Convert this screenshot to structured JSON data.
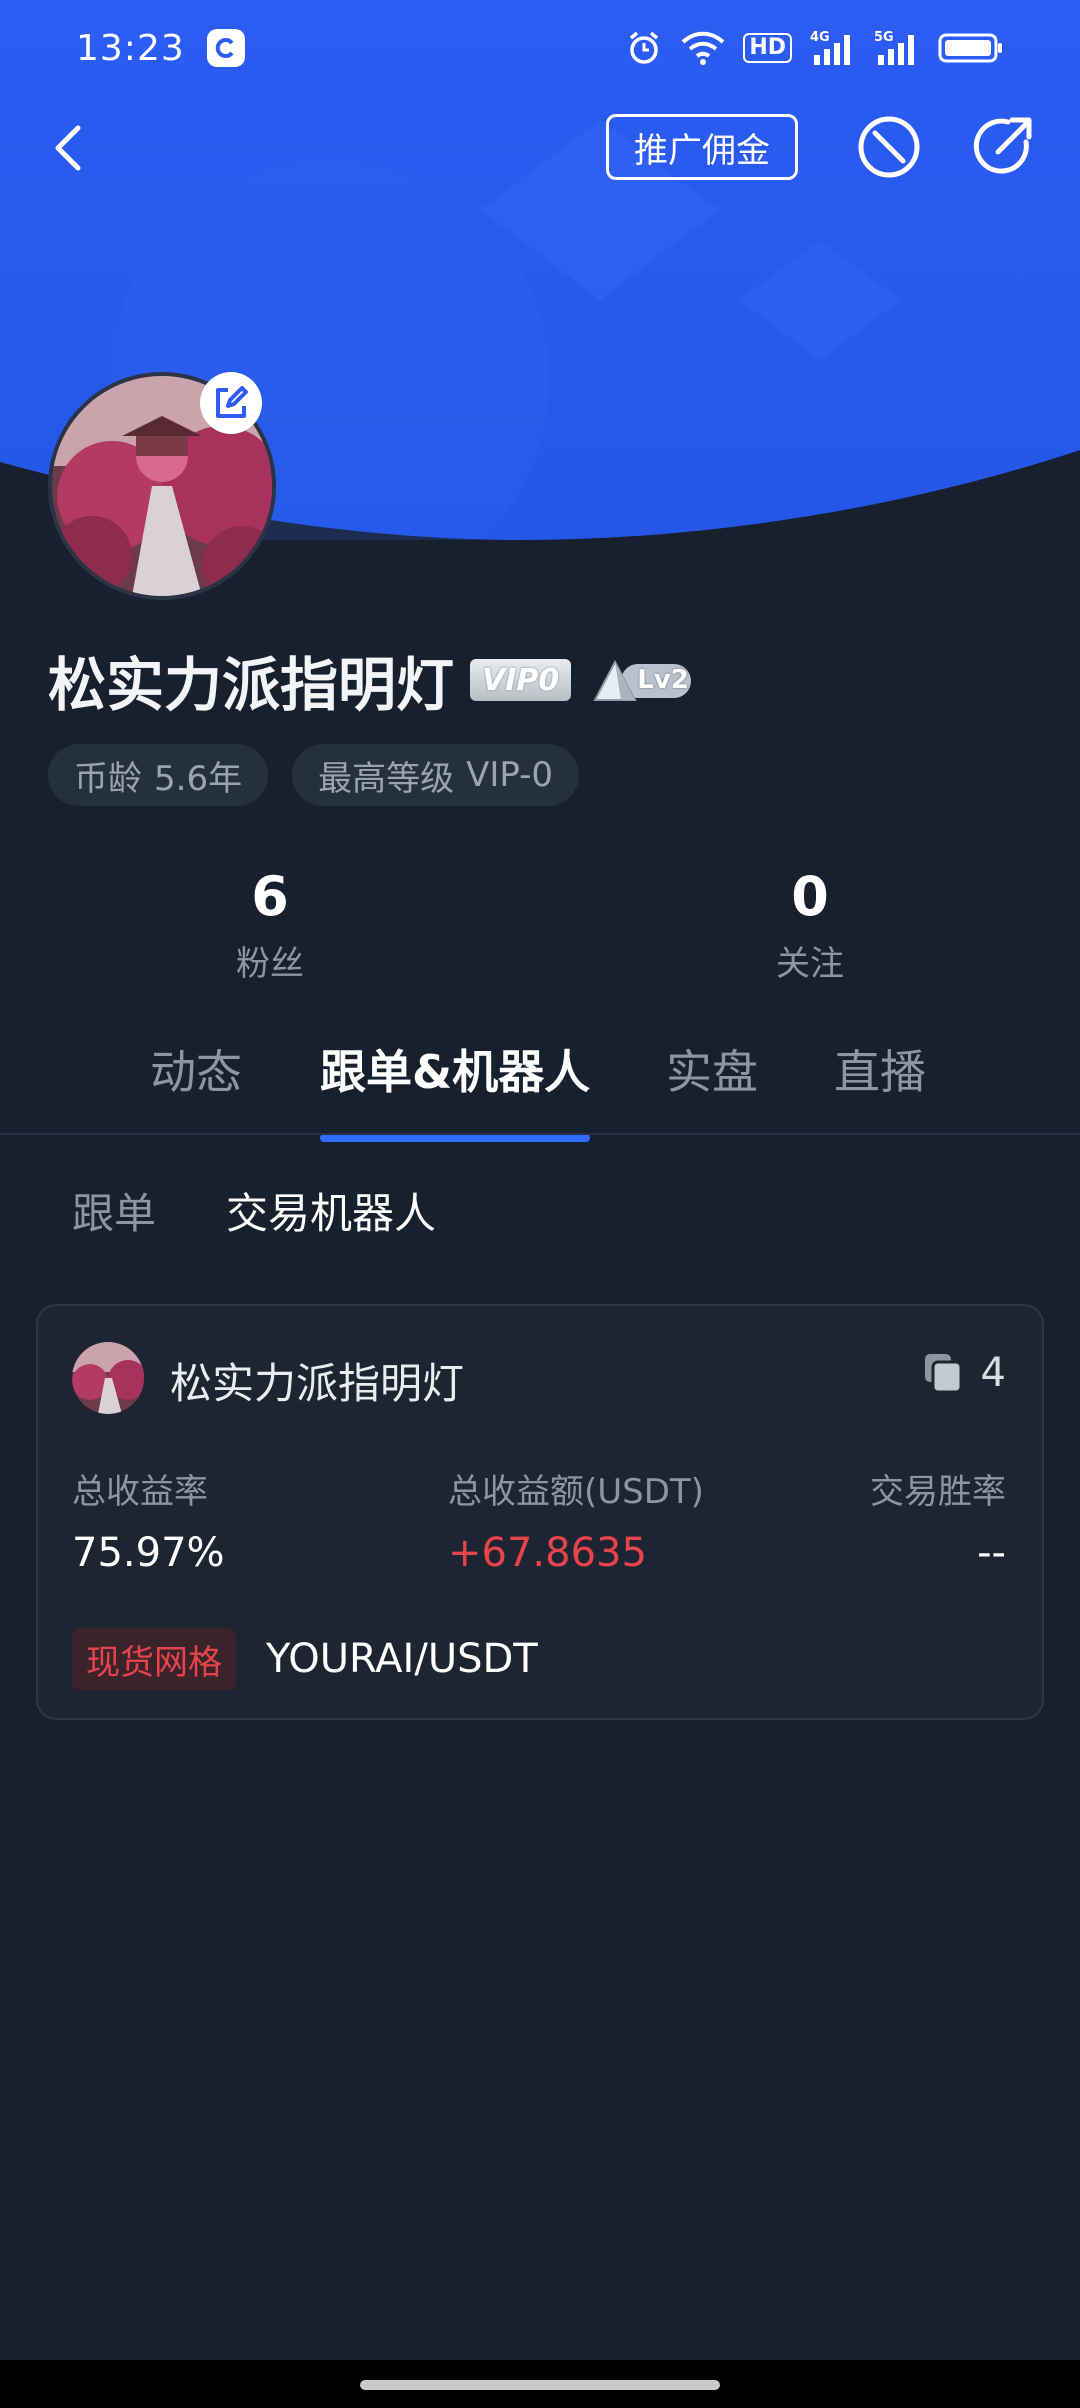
{
  "status_bar": {
    "time": "13:23",
    "hd_label": "HD",
    "net1": "4G",
    "net2": "5G"
  },
  "nav": {
    "promo_label": "推广佣金"
  },
  "profile": {
    "name": "松实力派指明灯",
    "vip_badge": "VIP0",
    "level_badge": "Lv2",
    "tags": [
      {
        "label": "币龄",
        "value": "5.6年"
      },
      {
        "label": "最高等级",
        "value": "VIP-0"
      }
    ],
    "stats": [
      {
        "value": "6",
        "label": "粉丝"
      },
      {
        "value": "0",
        "label": "关注"
      }
    ]
  },
  "tabs": [
    {
      "label": "动态",
      "active": false
    },
    {
      "label": "跟单&机器人",
      "active": true
    },
    {
      "label": "实盘",
      "active": false
    },
    {
      "label": "直播",
      "active": false
    }
  ],
  "subtabs": [
    {
      "label": "跟单",
      "active": false
    },
    {
      "label": "交易机器人",
      "active": true
    }
  ],
  "bot_card": {
    "name": "松实力派指明灯",
    "copy_count": "4",
    "metrics": [
      {
        "label": "总收益率",
        "value": "75.97%"
      },
      {
        "label": "总收益额(USDT)",
        "value": "+67.8635"
      },
      {
        "label": "交易胜率",
        "value": "--"
      }
    ],
    "strategy_tag": "现货网格",
    "pair": "YOURAI/USDT"
  },
  "colors": {
    "hero_blue": "#2f5cf0",
    "background": "#16202e",
    "accent": "#2f6bff",
    "positive": "#e8434b"
  }
}
